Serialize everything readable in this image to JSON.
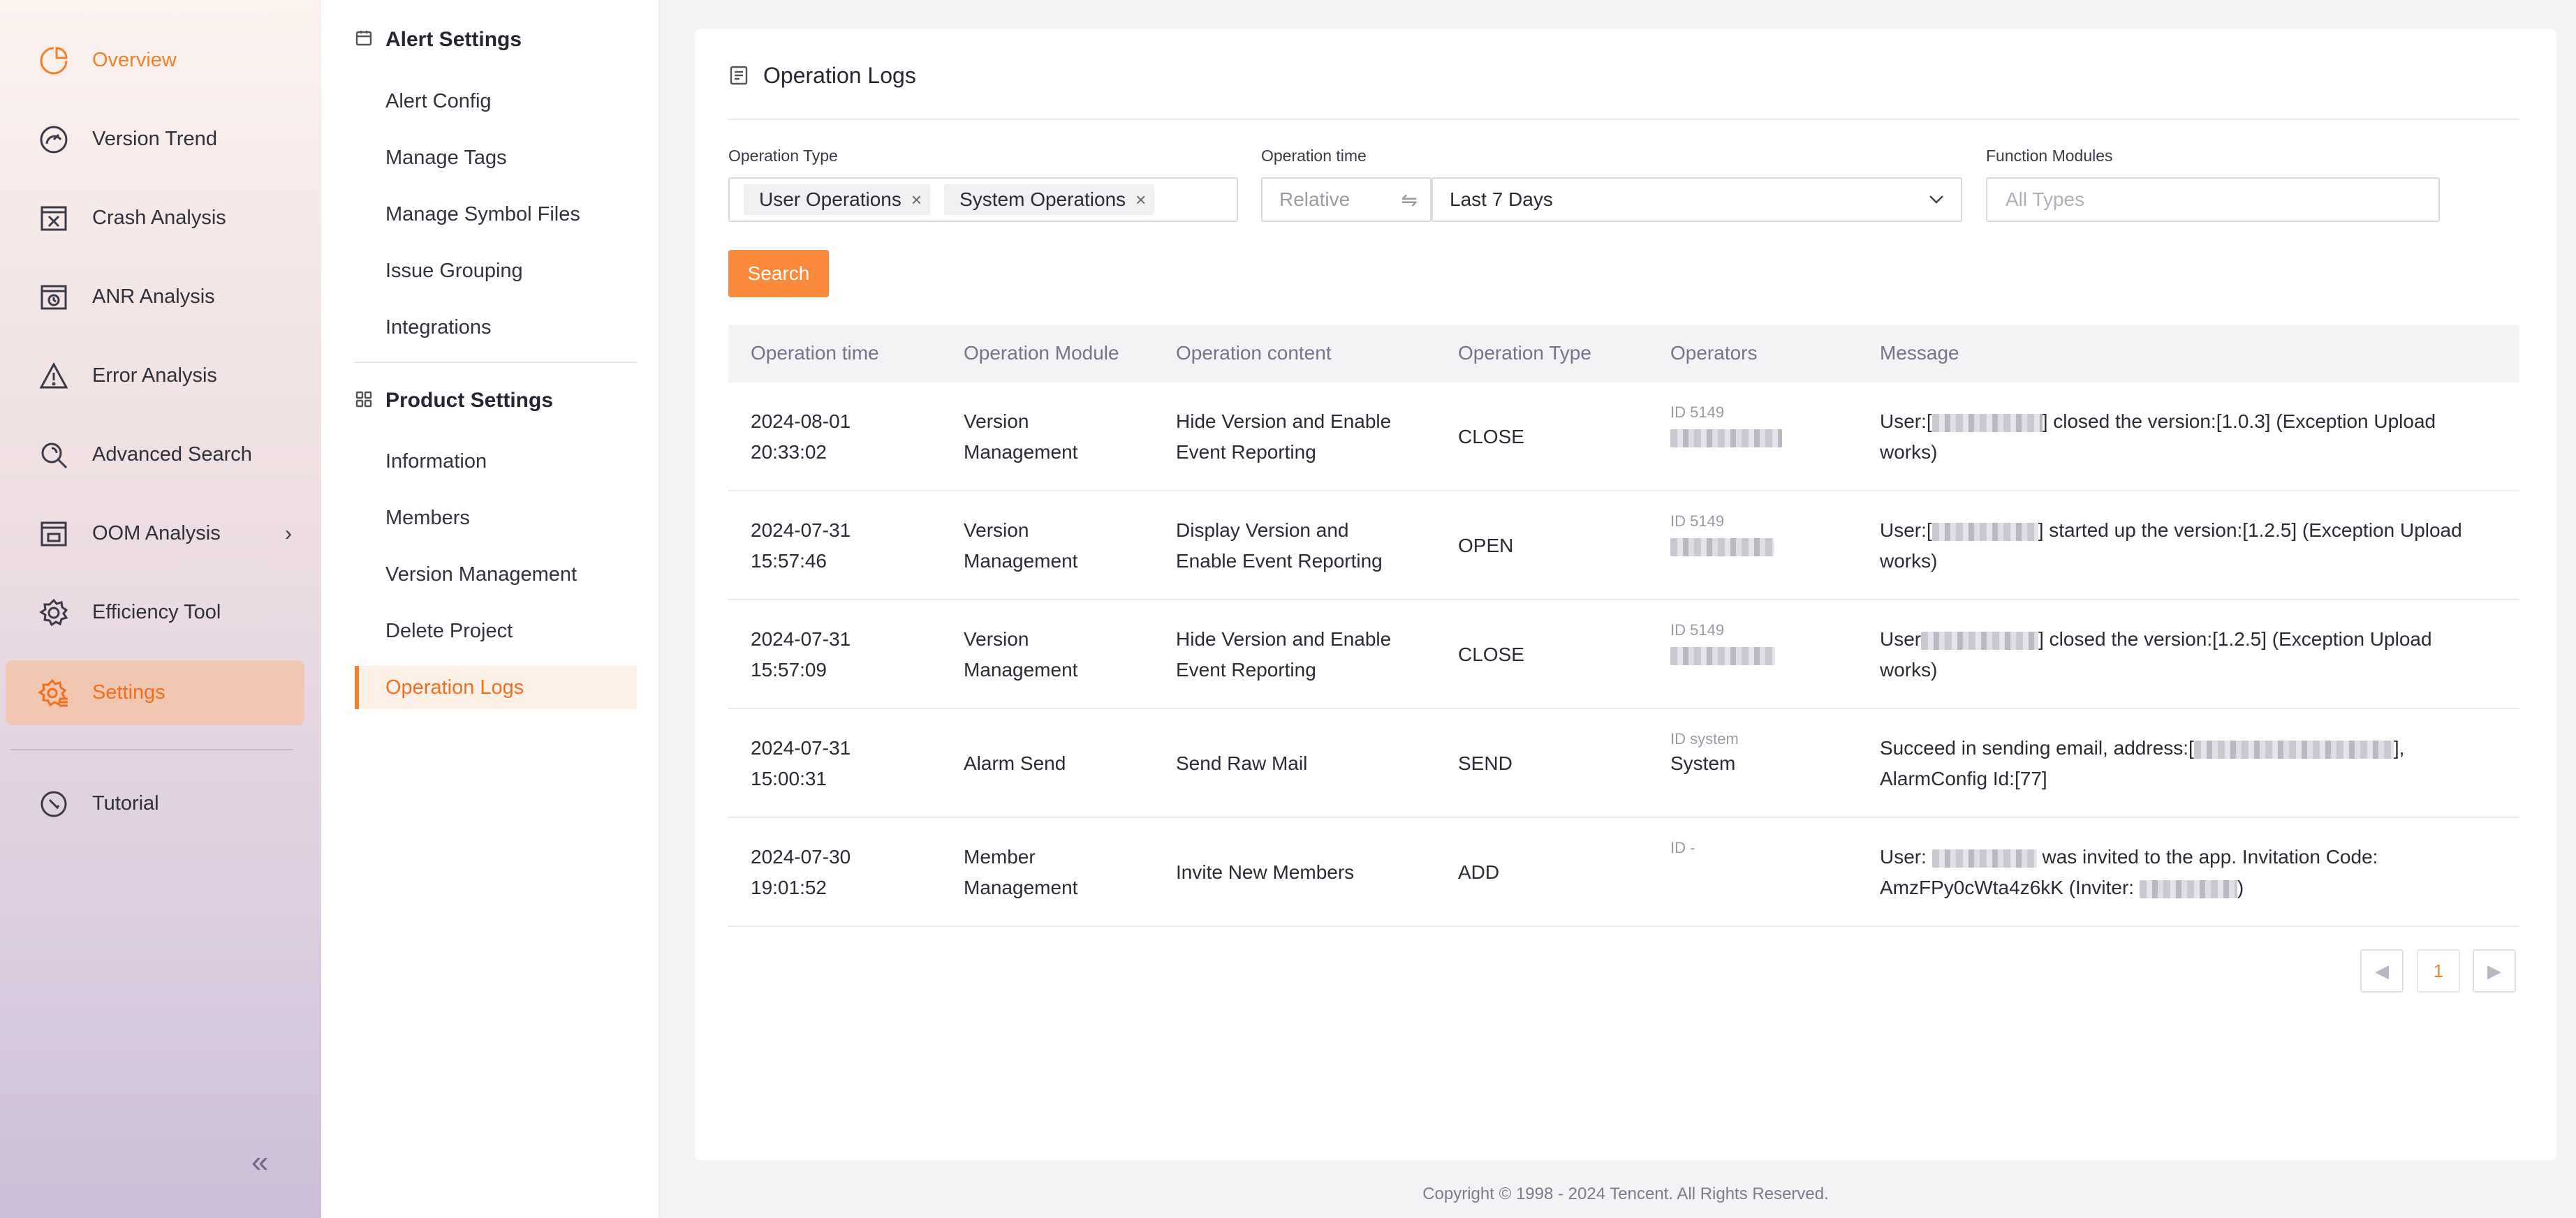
{
  "nav": {
    "items": [
      {
        "label": "Overview",
        "icon": "overview-icon"
      },
      {
        "label": "Version Trend",
        "icon": "version-trend-icon"
      },
      {
        "label": "Crash Analysis",
        "icon": "crash-analysis-icon"
      },
      {
        "label": "ANR Analysis",
        "icon": "anr-analysis-icon"
      },
      {
        "label": "Error Analysis",
        "icon": "error-analysis-icon"
      },
      {
        "label": "Advanced Search",
        "icon": "advanced-search-icon"
      },
      {
        "label": "OOM Analysis",
        "icon": "oom-analysis-icon"
      },
      {
        "label": "Efficiency Tool",
        "icon": "efficiency-tool-icon"
      },
      {
        "label": "Settings",
        "icon": "settings-icon"
      },
      {
        "label": "Tutorial",
        "icon": "tutorial-icon"
      }
    ],
    "selected": "Settings",
    "collapse_glyph": "«",
    "expand_glyph": "›"
  },
  "submenu": {
    "alert_heading": "Alert Settings",
    "alert_items": [
      "Alert Config",
      "Manage Tags",
      "Manage Symbol Files",
      "Issue Grouping",
      "Integrations"
    ],
    "product_heading": "Product Settings",
    "product_items": [
      "Information",
      "Members",
      "Version Management",
      "Delete Project",
      "Operation Logs"
    ],
    "active": "Operation Logs"
  },
  "page": {
    "title": "Operation Logs"
  },
  "filters": {
    "operation_type_label": "Operation Type",
    "operation_type_tags": [
      "User Operations",
      "System Operations"
    ],
    "tag_remove_glyph": "×",
    "operation_time_label": "Operation time",
    "relative_label": "Relative",
    "swap_glyph": "⇋",
    "time_range_value": "Last 7 Days",
    "function_modules_label": "Function Modules",
    "function_modules_placeholder": "All Types",
    "search_label": "Search"
  },
  "table": {
    "headers": [
      "Operation time",
      "Operation Module",
      "Operation content",
      "Operation Type",
      "Operators",
      "Message"
    ],
    "rows": [
      {
        "date": "2024-08-01",
        "time": "20:33:02",
        "module_1": "Version",
        "module_2": "Management",
        "content_1": "Hide Version and Enable",
        "content_2": "Event Reporting",
        "type": "CLOSE",
        "operator_id": "ID 5149",
        "operator_name": "",
        "msg_pre": "User:[",
        "msg_post": "] closed the version:[1.0.3] (Exception Upload works)"
      },
      {
        "date": "2024-07-31",
        "time": "15:57:46",
        "module_1": "Version",
        "module_2": "Management",
        "content_1": "Display Version and",
        "content_2": "Enable Event Reporting",
        "type": "OPEN",
        "operator_id": "ID 5149",
        "operator_name": "",
        "msg_pre": "User:[",
        "msg_post": "] started up the version:[1.2.5] (Exception Upload works)"
      },
      {
        "date": "2024-07-31",
        "time": "15:57:09",
        "module_1": "Version",
        "module_2": "Management",
        "content_1": "Hide Version and Enable",
        "content_2": "Event Reporting",
        "type": "CLOSE",
        "operator_id": "ID 5149",
        "operator_name": "",
        "msg_pre": "User",
        "msg_post": "] closed the version:[1.2.5] (Exception Upload works)"
      },
      {
        "date": "2024-07-31",
        "time": "15:00:31",
        "module_1": "Alarm Send",
        "module_2": "",
        "content_1": "Send Raw Mail",
        "content_2": "",
        "type": "SEND",
        "operator_id": "ID system",
        "operator_name": "System",
        "msg_pre": "Succeed in sending email, address:[",
        "msg_post": "], AlarmConfig Id:[77]"
      },
      {
        "date": "2024-07-30",
        "time": "19:01:52",
        "module_1": "Member",
        "module_2": "Management",
        "content_1": "Invite New Members",
        "content_2": "",
        "type": "ADD",
        "operator_id": "ID -",
        "operator_name": "",
        "msg_pre": "User: ",
        "msg_post": " was invited to the app. Invitation Code: AmzFPy0cWta4z6kK (Inviter: ",
        "msg_tail": ")"
      }
    ]
  },
  "pagination": {
    "prev_glyph": "◀",
    "current": "1",
    "next_glyph": "▶"
  },
  "footer": {
    "copyright": "Copyright © 1998 - 2024 Tencent. All Rights Reserved."
  },
  "colors": {
    "accent": "#f57f2a",
    "selected_bg": "#f2c7b2",
    "search_button": "#f98a3c"
  }
}
